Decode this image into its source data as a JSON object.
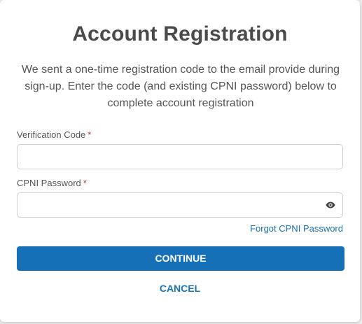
{
  "dialog": {
    "title": "Account Registration",
    "description": "We sent a one-time registration code to the email provide during sign-up. Enter the code (and existing CPNI password) below to complete account registration"
  },
  "fields": {
    "verification_code": {
      "label": "Verification Code",
      "required_mark": "*",
      "value": "",
      "placeholder": ""
    },
    "cpni_password": {
      "label": "CPNI Password",
      "required_mark": "*",
      "value": "",
      "placeholder": "",
      "toggle_icon": "eye-icon"
    }
  },
  "links": {
    "forgot_password": "Forgot CPNI Password"
  },
  "buttons": {
    "continue": "CONTINUE",
    "cancel": "CANCEL"
  },
  "colors": {
    "primary": "#1670b8",
    "link": "#1a73b8",
    "required": "#c0392b",
    "title": "#4a4a4a"
  }
}
